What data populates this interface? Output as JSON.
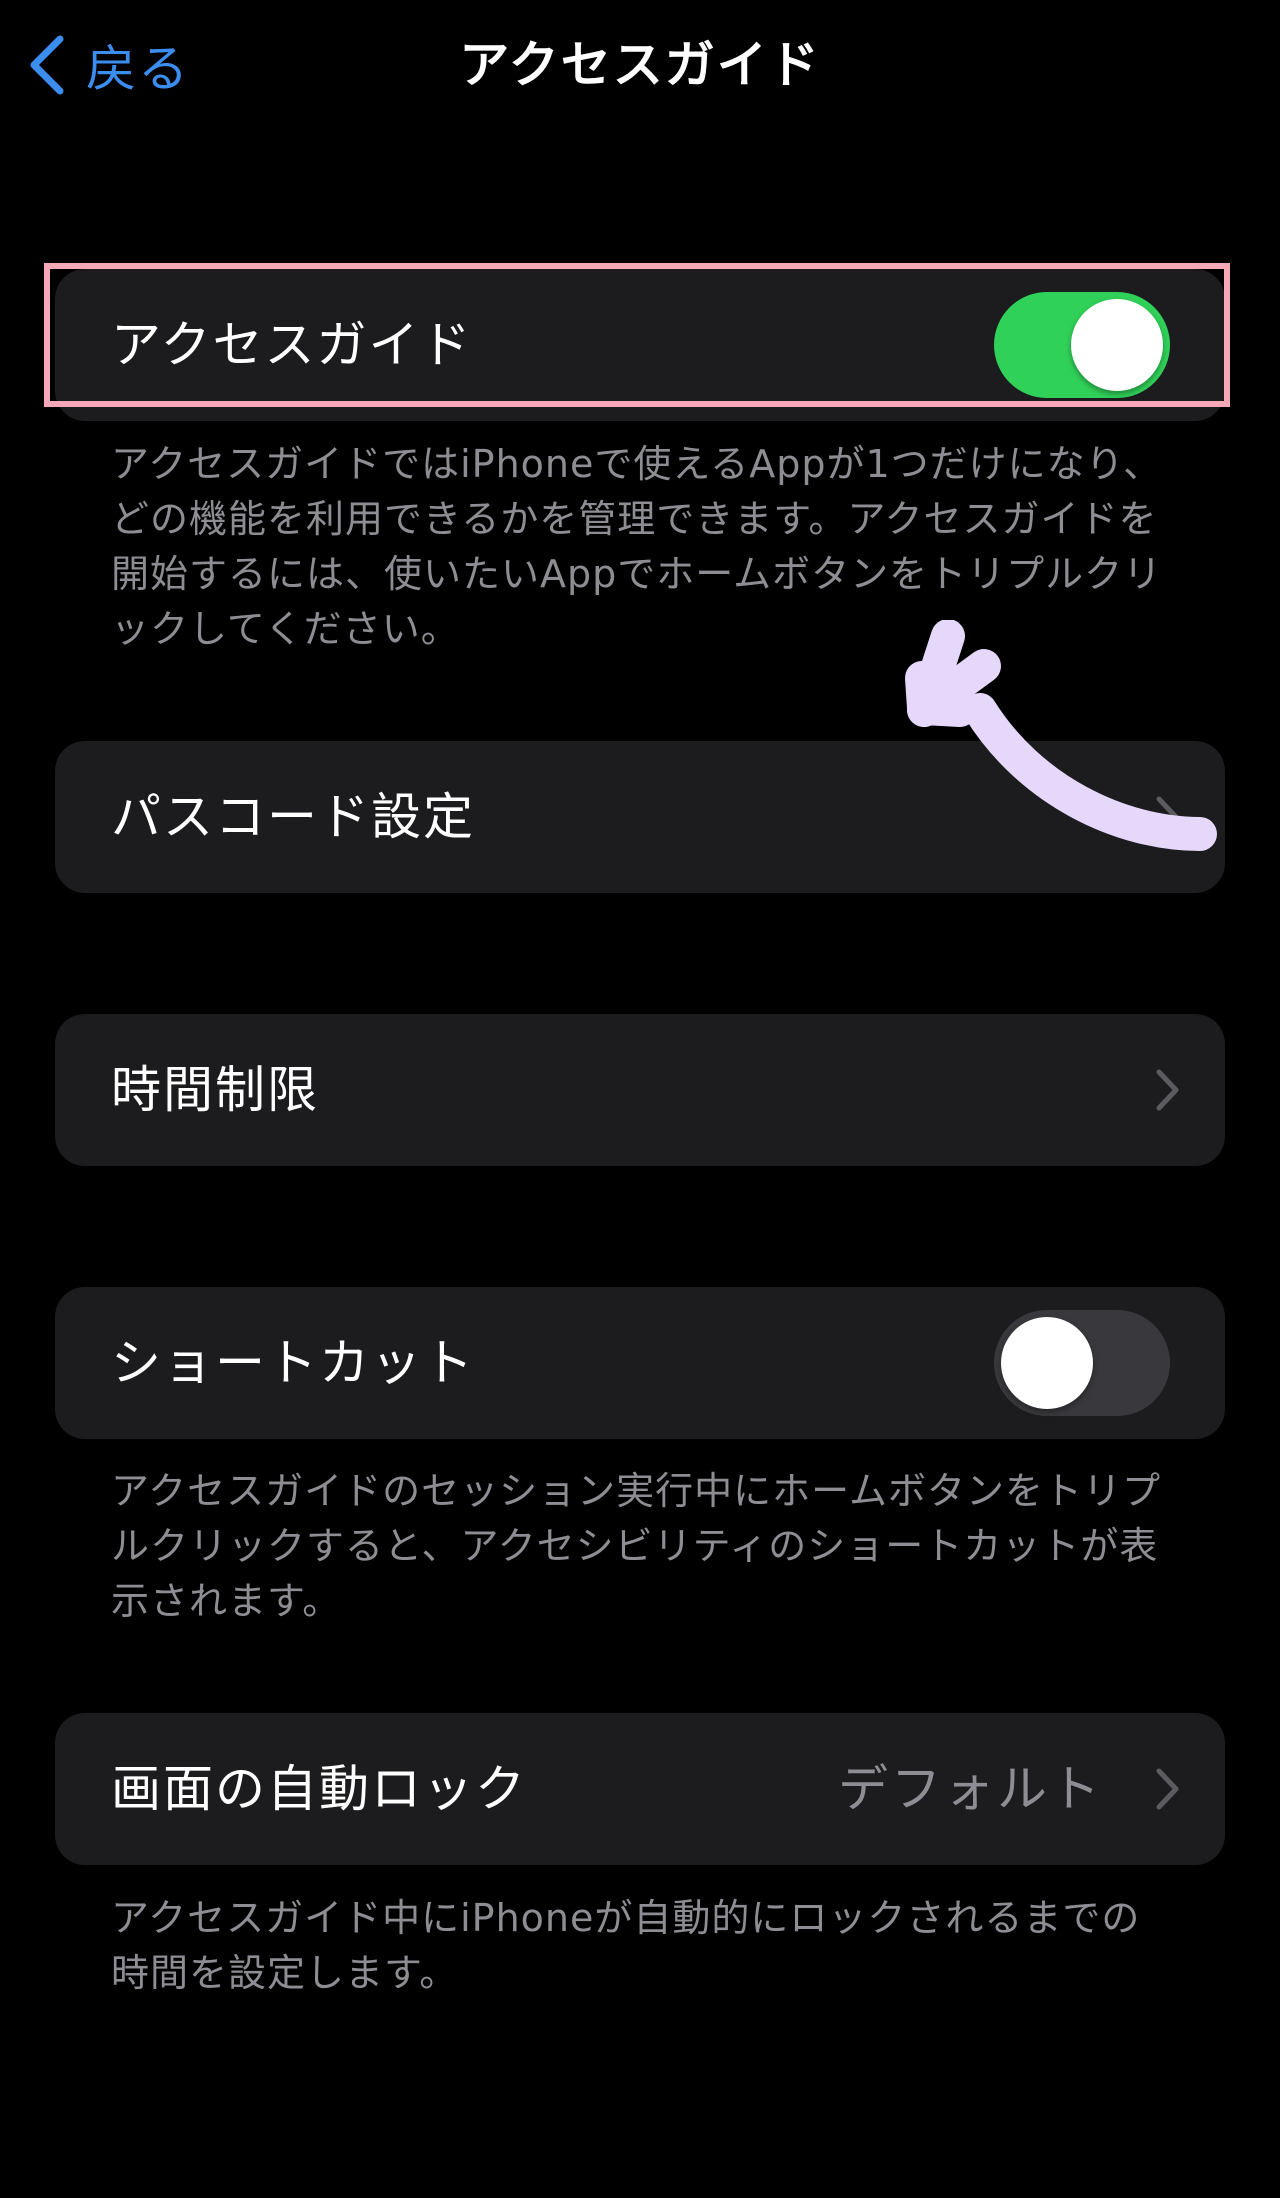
{
  "nav": {
    "back_label": "戻る",
    "title": "アクセスガイド"
  },
  "guided_access": {
    "label": "アクセスガイド",
    "enabled": true,
    "footer": "アクセスガイドではiPhoneで使えるAppが1つだけになり、どの機能を利用できるかを管理できます。アクセスガイドを開始するには、使いたいAppでホームボタンをトリプルクリックしてください。"
  },
  "passcode_settings": {
    "label": "パスコード設定"
  },
  "time_limits": {
    "label": "時間制限"
  },
  "shortcut": {
    "label": "ショートカット",
    "enabled": false,
    "footer": "アクセスガイドのセッション実行中にホームボタンをトリプルクリックすると、アクセシビリティのショートカットが表示されます。"
  },
  "auto_lock": {
    "label": "画面の自動ロック",
    "value": "デフォルト",
    "footer": "アクセスガイド中にiPhoneが自動的にロックされるまでの時間を設定します。"
  },
  "colors": {
    "background": "#000000",
    "cell": "#1c1c1e",
    "accent": "#3b8ef0",
    "switch_on": "#30d158",
    "switch_off": "#39393d",
    "secondary_text": "#8d8d93",
    "highlight_border": "#f4a8b8",
    "annotation_arrow": "#e6d8fb"
  }
}
